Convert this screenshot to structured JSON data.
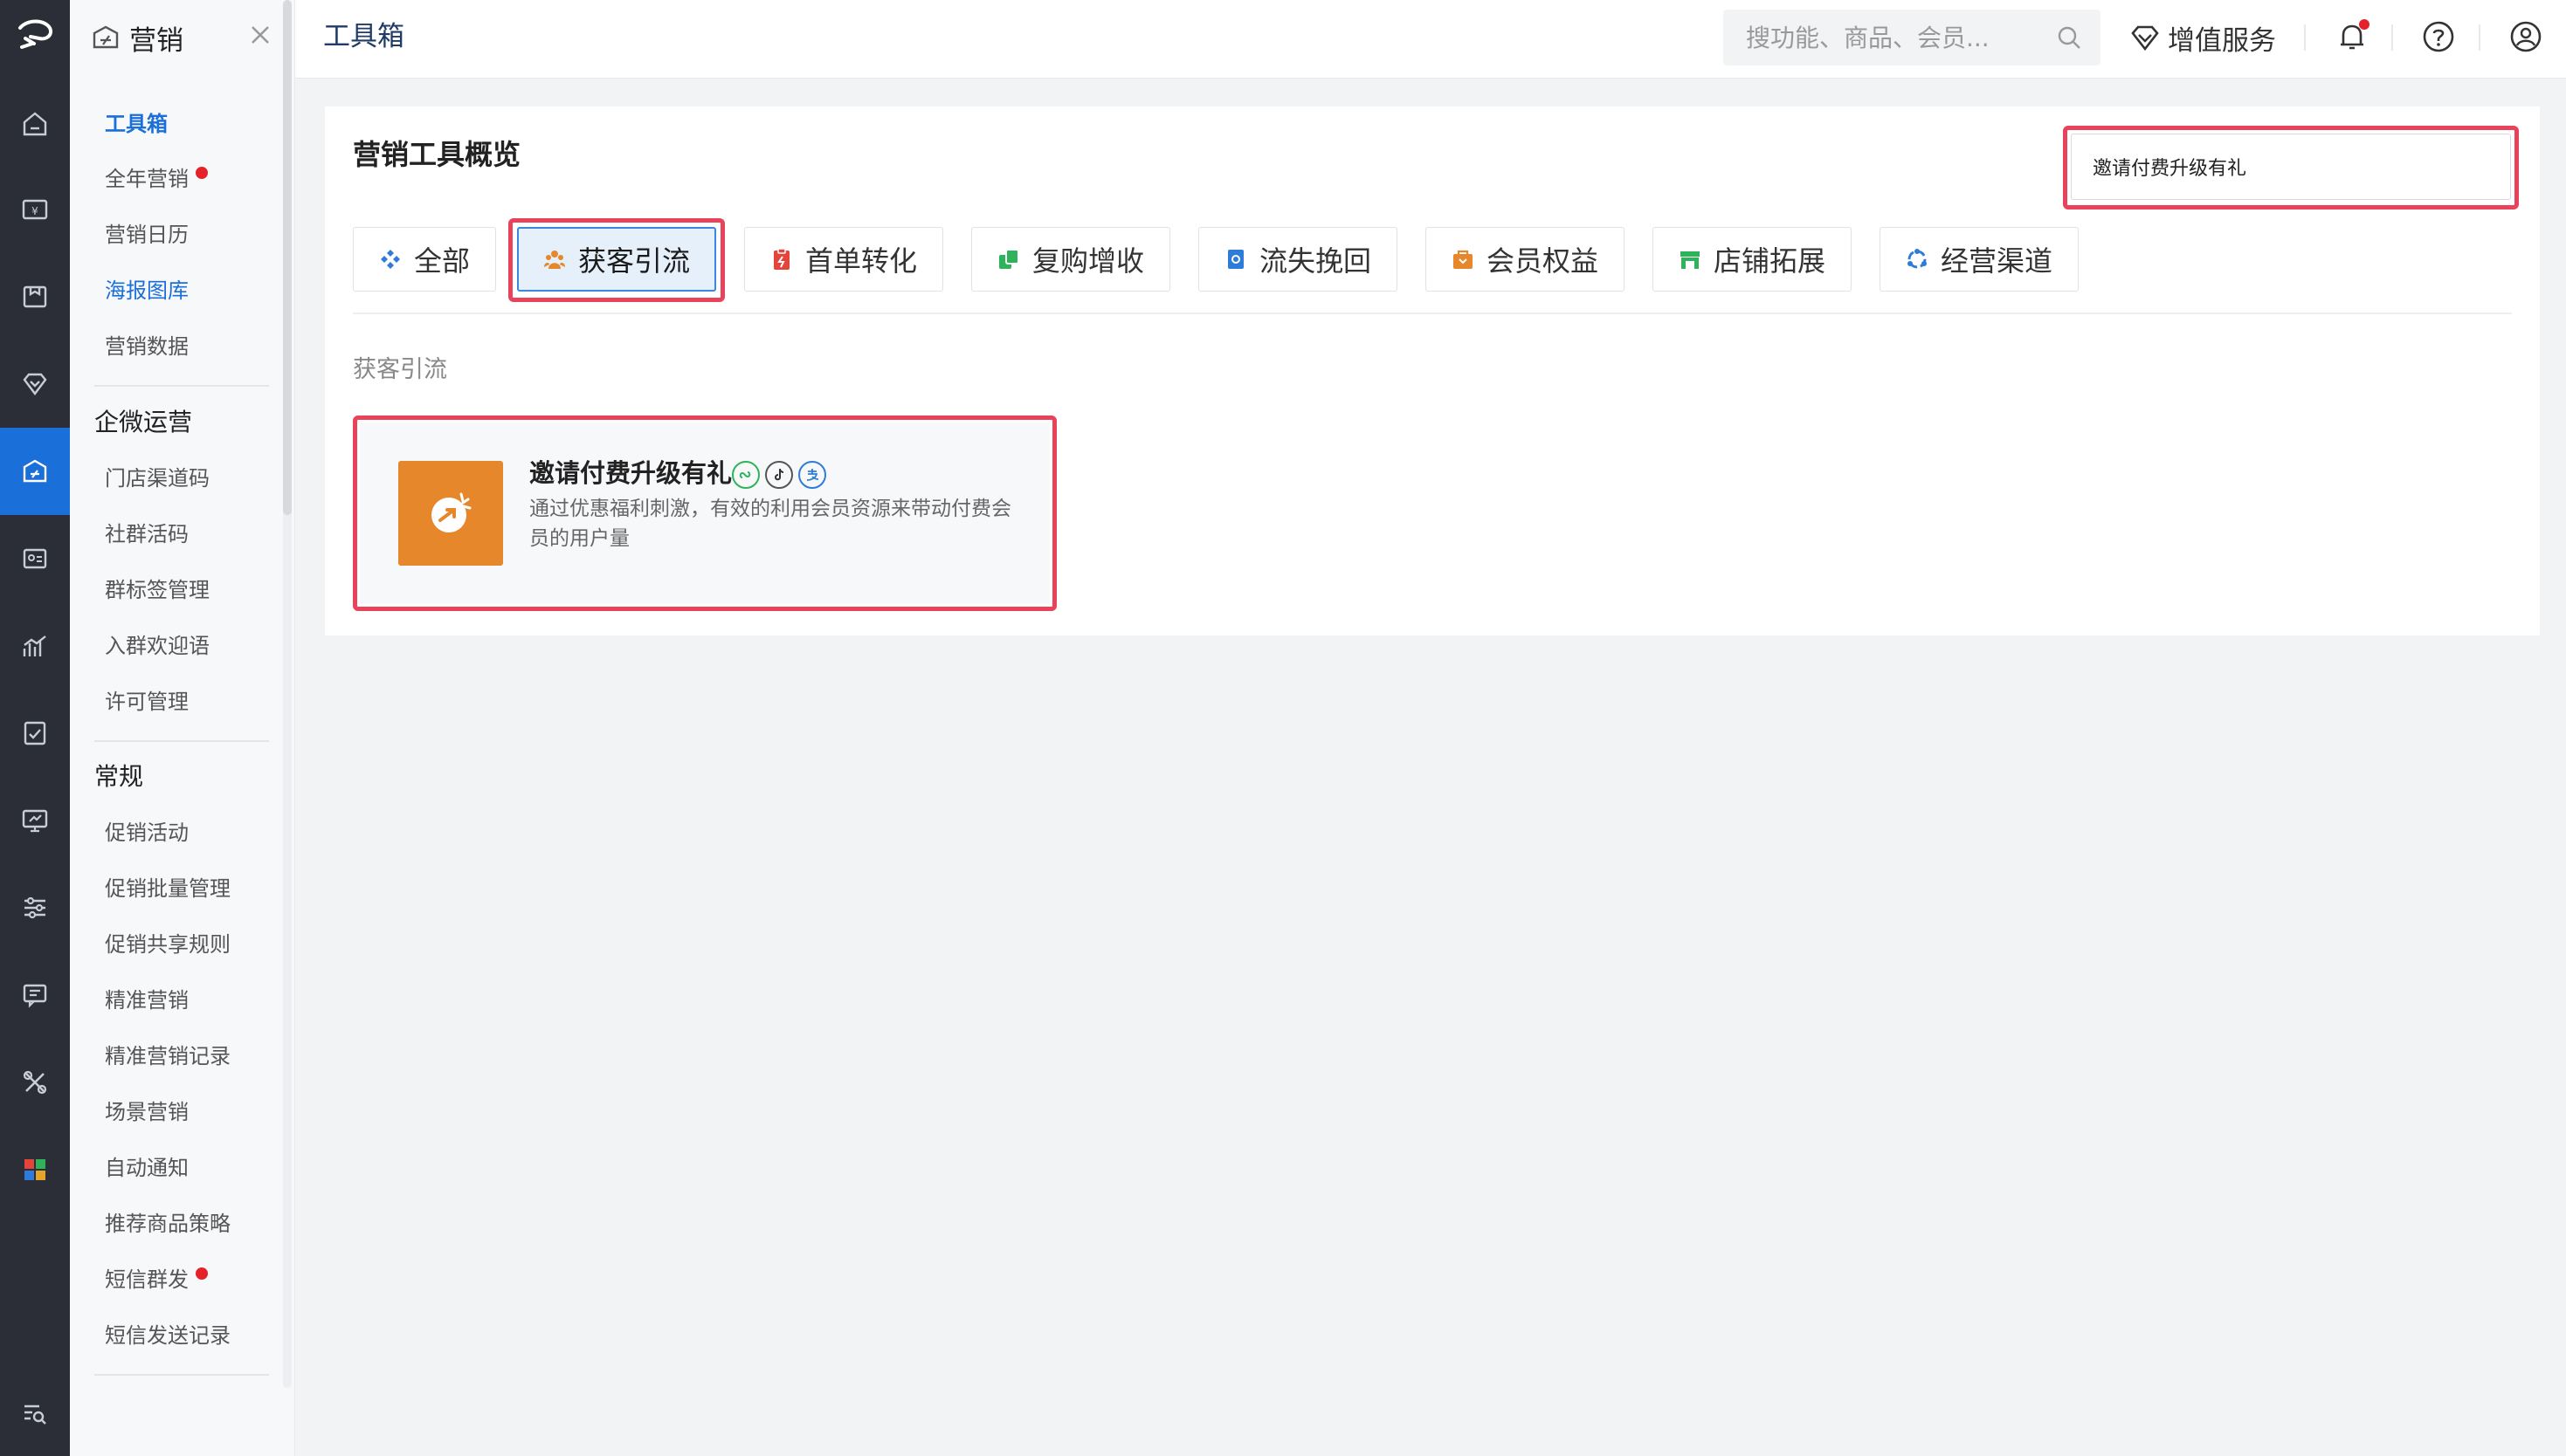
{
  "menu": {
    "title": "营销",
    "items_top": [
      {
        "label": "工具箱",
        "state": "active"
      },
      {
        "label": "全年营销",
        "dot": true
      },
      {
        "label": "营销日历"
      },
      {
        "label": "海报图库",
        "state": "blue"
      },
      {
        "label": "营销数据"
      }
    ],
    "group_qw": "企微运营",
    "items_qw": [
      {
        "label": "门店渠道码"
      },
      {
        "label": "社群活码"
      },
      {
        "label": "群标签管理"
      },
      {
        "label": "入群欢迎语"
      },
      {
        "label": "许可管理"
      }
    ],
    "group_general": "常规",
    "items_general": [
      {
        "label": "促销活动"
      },
      {
        "label": "促销批量管理"
      },
      {
        "label": "促销共享规则"
      },
      {
        "label": "精准营销"
      },
      {
        "label": "精准营销记录"
      },
      {
        "label": "场景营销"
      },
      {
        "label": "自动通知"
      },
      {
        "label": "推荐商品策略"
      },
      {
        "label": "短信群发",
        "dot": true
      },
      {
        "label": "短信发送记录"
      }
    ]
  },
  "rail": {
    "icons": [
      "logo-icon",
      "home-icon",
      "cashier-icon",
      "product-icon",
      "member-icon",
      "marketing-icon",
      "card-icon",
      "report-icon",
      "check-icon",
      "monitor-icon",
      "settings-icon",
      "message-icon",
      "tools-icon",
      "apps-icon",
      "search-menu-icon"
    ]
  },
  "topbar": {
    "breadcrumb": "工具箱",
    "search_placeholder": "搜功能、商品、会员...",
    "vas_label": "增值服务"
  },
  "main": {
    "title": "营销工具概览",
    "search_value": "邀请付费升级有礼",
    "tabs": [
      {
        "label": "全部",
        "icon": "diamond-icon",
        "color": "#2f7bd9"
      },
      {
        "label": "获客引流",
        "icon": "people-icon",
        "color": "#e5872a",
        "active": true
      },
      {
        "label": "首单转化",
        "icon": "clipboard-icon",
        "color": "#e5443b"
      },
      {
        "label": "复购增收",
        "icon": "repeat-icon",
        "color": "#2fb35a"
      },
      {
        "label": "流失挽回",
        "icon": "document-icon",
        "color": "#2f7bd9"
      },
      {
        "label": "会员权益",
        "icon": "bag-icon",
        "color": "#e5872a"
      },
      {
        "label": "店铺拓展",
        "icon": "store-icon",
        "color": "#2fb35a"
      },
      {
        "label": "经营渠道",
        "icon": "channel-icon",
        "color": "#2f7bd9"
      }
    ],
    "section_label": "获客引流",
    "tool": {
      "name": "邀请付费升级有礼",
      "desc": "通过优惠福利刺激，有效的利用会员资源来带动付费会员的用户量",
      "icon_color": "#e5872a",
      "badges": [
        "mini-program-icon",
        "douyin-icon",
        "alipay-icon"
      ]
    }
  },
  "colors": {
    "accent": "#1a6fd8",
    "highlight": "#e8435a",
    "rail_bg": "#2b2e36"
  }
}
